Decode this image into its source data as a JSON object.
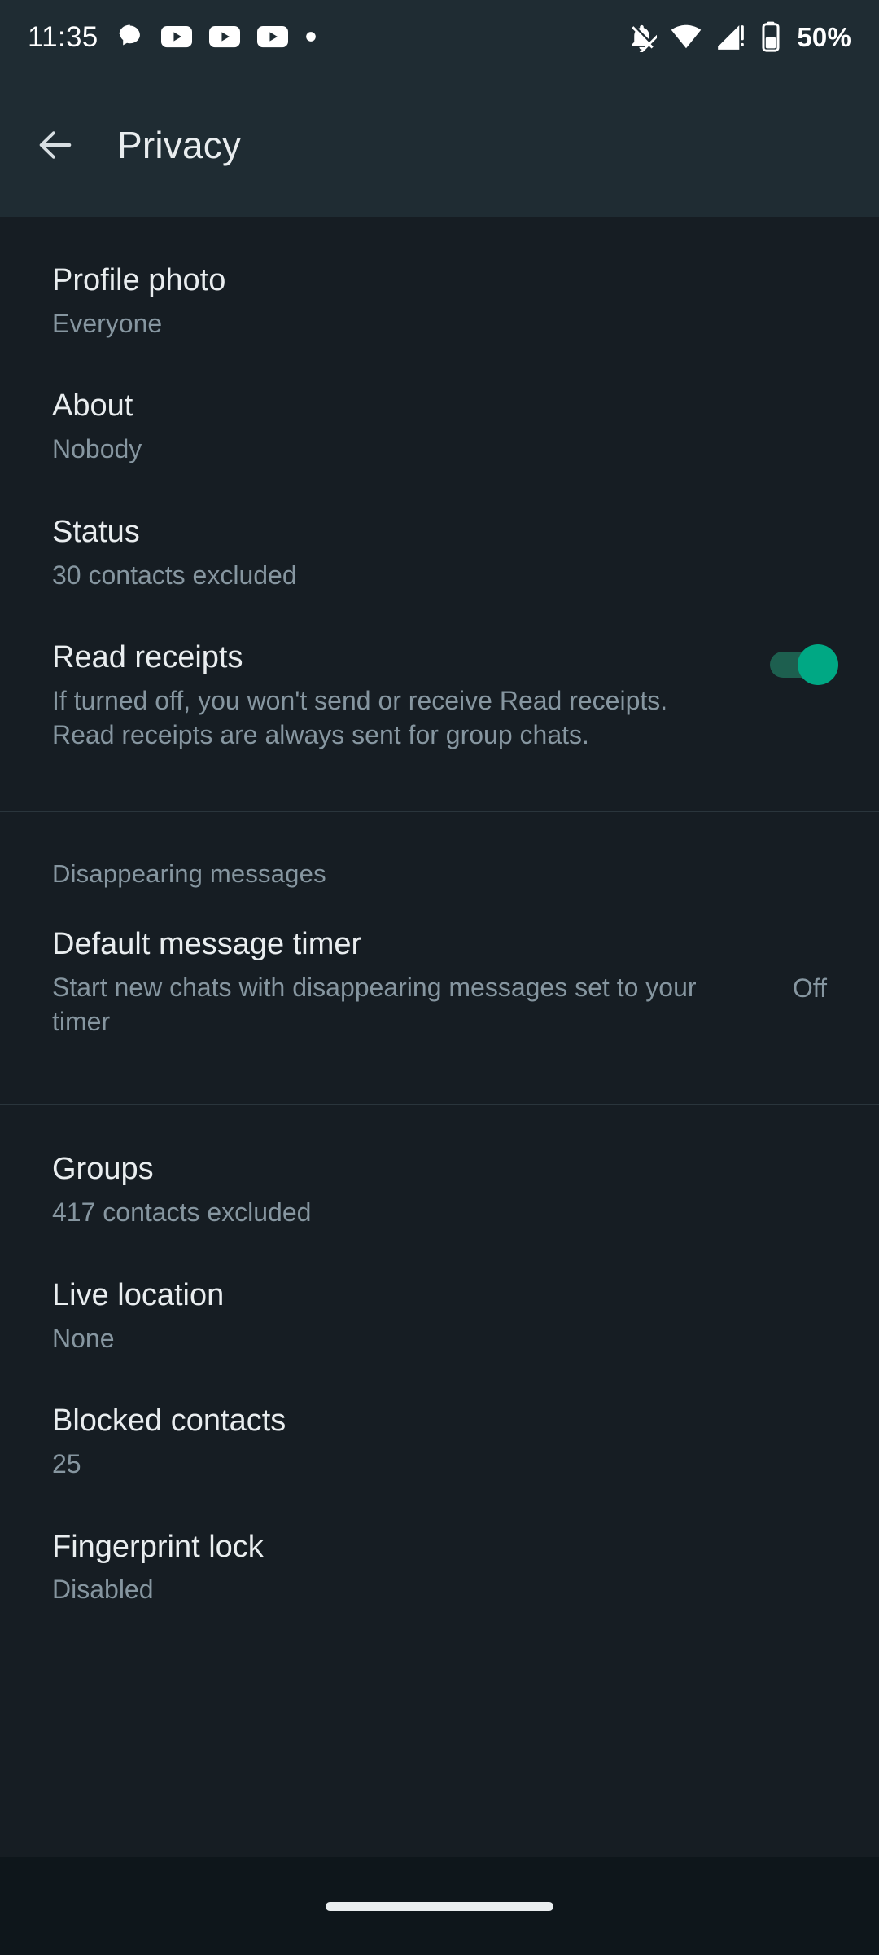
{
  "status_bar": {
    "time": "11:35",
    "battery_percent": "50%",
    "notification_icons": [
      "chat-bubble-icon",
      "youtube-icon",
      "youtube-icon",
      "youtube-icon",
      "dot-icon"
    ],
    "system_icons": [
      "bell-off-icon",
      "wifi-icon",
      "cellular-signal-warning-icon",
      "battery-icon"
    ]
  },
  "header": {
    "back_icon": "arrow-back-icon",
    "title": "Privacy"
  },
  "sections": [
    {
      "id": "visibility",
      "label": null,
      "rows": [
        {
          "title": "Profile photo",
          "subtitle": "Everyone",
          "value": null,
          "control": null
        },
        {
          "title": "About",
          "subtitle": "Nobody",
          "value": null,
          "control": null
        },
        {
          "title": "Status",
          "subtitle": "30 contacts excluded",
          "value": null,
          "control": null
        },
        {
          "title": "Read receipts",
          "subtitle": "If turned off, you won't send or receive Read receipts. Read receipts are always sent for group chats.",
          "value": null,
          "control": "toggle",
          "toggle_on": true
        }
      ]
    },
    {
      "id": "disappearing-messages",
      "label": "Disappearing messages",
      "rows": [
        {
          "title": "Default message timer",
          "subtitle": "Start new chats with disappearing messages set to your timer",
          "value": "Off",
          "control": null
        }
      ]
    },
    {
      "id": "other",
      "label": null,
      "rows": [
        {
          "title": "Groups",
          "subtitle": "417 contacts excluded",
          "value": null,
          "control": null
        },
        {
          "title": "Live location",
          "subtitle": "None",
          "value": null,
          "control": null
        },
        {
          "title": "Blocked contacts",
          "subtitle": "25",
          "value": null,
          "control": null
        },
        {
          "title": "Fingerprint lock",
          "subtitle": "Disabled",
          "value": null,
          "control": null
        }
      ]
    }
  ],
  "navigation_bar": {
    "gesture_pill": "home-gesture-pill"
  },
  "colors": {
    "header_bg": "#1f2c33",
    "content_bg": "#161d23",
    "nav_bg": "#0e161b",
    "primary_text": "#e9edef",
    "secondary_text": "#8696a0",
    "divider": "#2a353c",
    "toggle_on_thumb": "#00a884",
    "toggle_on_track": "#1d5f4f"
  }
}
